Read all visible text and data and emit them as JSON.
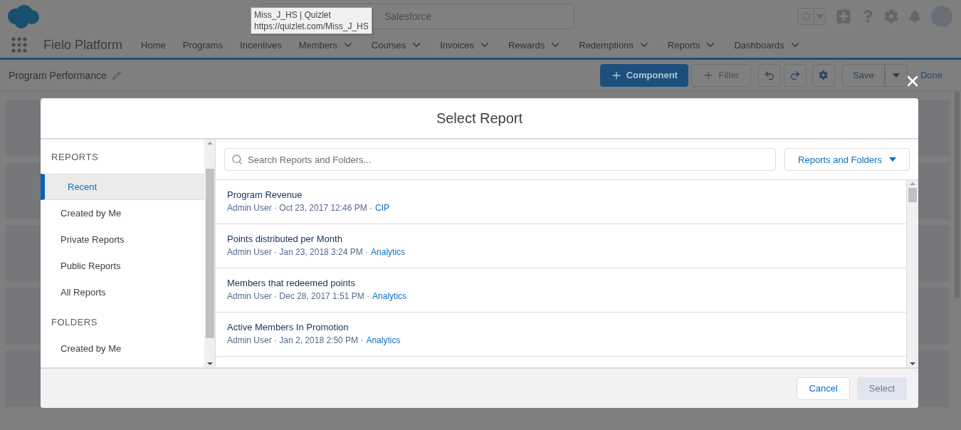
{
  "header": {
    "search_text": "Salesforce"
  },
  "tooltip": {
    "title": "Miss_J_HS | Quizlet",
    "url": "https://quizlet.com/Miss_J_HS"
  },
  "nav": {
    "app_name": "Fielo Platform",
    "items": [
      {
        "label": "Home",
        "has_menu": false
      },
      {
        "label": "Programs",
        "has_menu": false
      },
      {
        "label": "Incentives",
        "has_menu": false
      },
      {
        "label": "Members",
        "has_menu": true
      },
      {
        "label": "Courses",
        "has_menu": true
      },
      {
        "label": "Invoices",
        "has_menu": true
      },
      {
        "label": "Rewards",
        "has_menu": true
      },
      {
        "label": "Redemptions",
        "has_menu": true
      },
      {
        "label": "Reports",
        "has_menu": true
      },
      {
        "label": "Dashboards",
        "has_menu": true
      }
    ]
  },
  "toolbar": {
    "title": "Program Performance",
    "buttons": [
      {
        "kind": "primary",
        "label": "Component"
      },
      {
        "kind": "disabled",
        "label": "Filter"
      },
      {
        "kind": "undo"
      },
      {
        "kind": "redo"
      },
      {
        "kind": "gear"
      },
      {
        "kind": "save",
        "label": "Save"
      },
      {
        "kind": "menu"
      },
      {
        "kind": "link",
        "label": "Done"
      }
    ]
  },
  "modal": {
    "title": "Select Report",
    "sections": [
      {
        "heading": "REPORTS",
        "items": [
          {
            "label": "Recent",
            "selected": true
          },
          {
            "label": "Created by Me",
            "selected": false
          },
          {
            "label": "Private Reports",
            "selected": false
          },
          {
            "label": "Public Reports",
            "selected": false
          },
          {
            "label": "All Reports",
            "selected": false
          }
        ]
      },
      {
        "heading": "FOLDERS",
        "items": [
          {
            "label": "Created by Me",
            "selected": false
          }
        ]
      }
    ],
    "search": {
      "placeholder": "Search Reports and Folders..."
    },
    "filter": "Reports and Folders",
    "reports": [
      {
        "name": "Program Revenue",
        "meta": "Admin User · Oct 23, 2017 12:46 PM ·",
        "folder": "CIP"
      },
      {
        "name": "Points distributed per Month",
        "meta": "Admin User · Jan 23, 2018 3:24 PM ·",
        "folder": "Analytics"
      },
      {
        "name": "Members that redeemed points",
        "meta": "Admin User · Dec 28, 2017 1:51 PM ·",
        "folder": "Analytics"
      },
      {
        "name": "Active Members In Promotion",
        "meta": "Admin User · Jan 2, 2018 2:50 PM ·",
        "folder": "Analytics"
      }
    ],
    "cancel": "Cancel",
    "select": {
      "label": "Select",
      "disabled": true
    }
  }
}
